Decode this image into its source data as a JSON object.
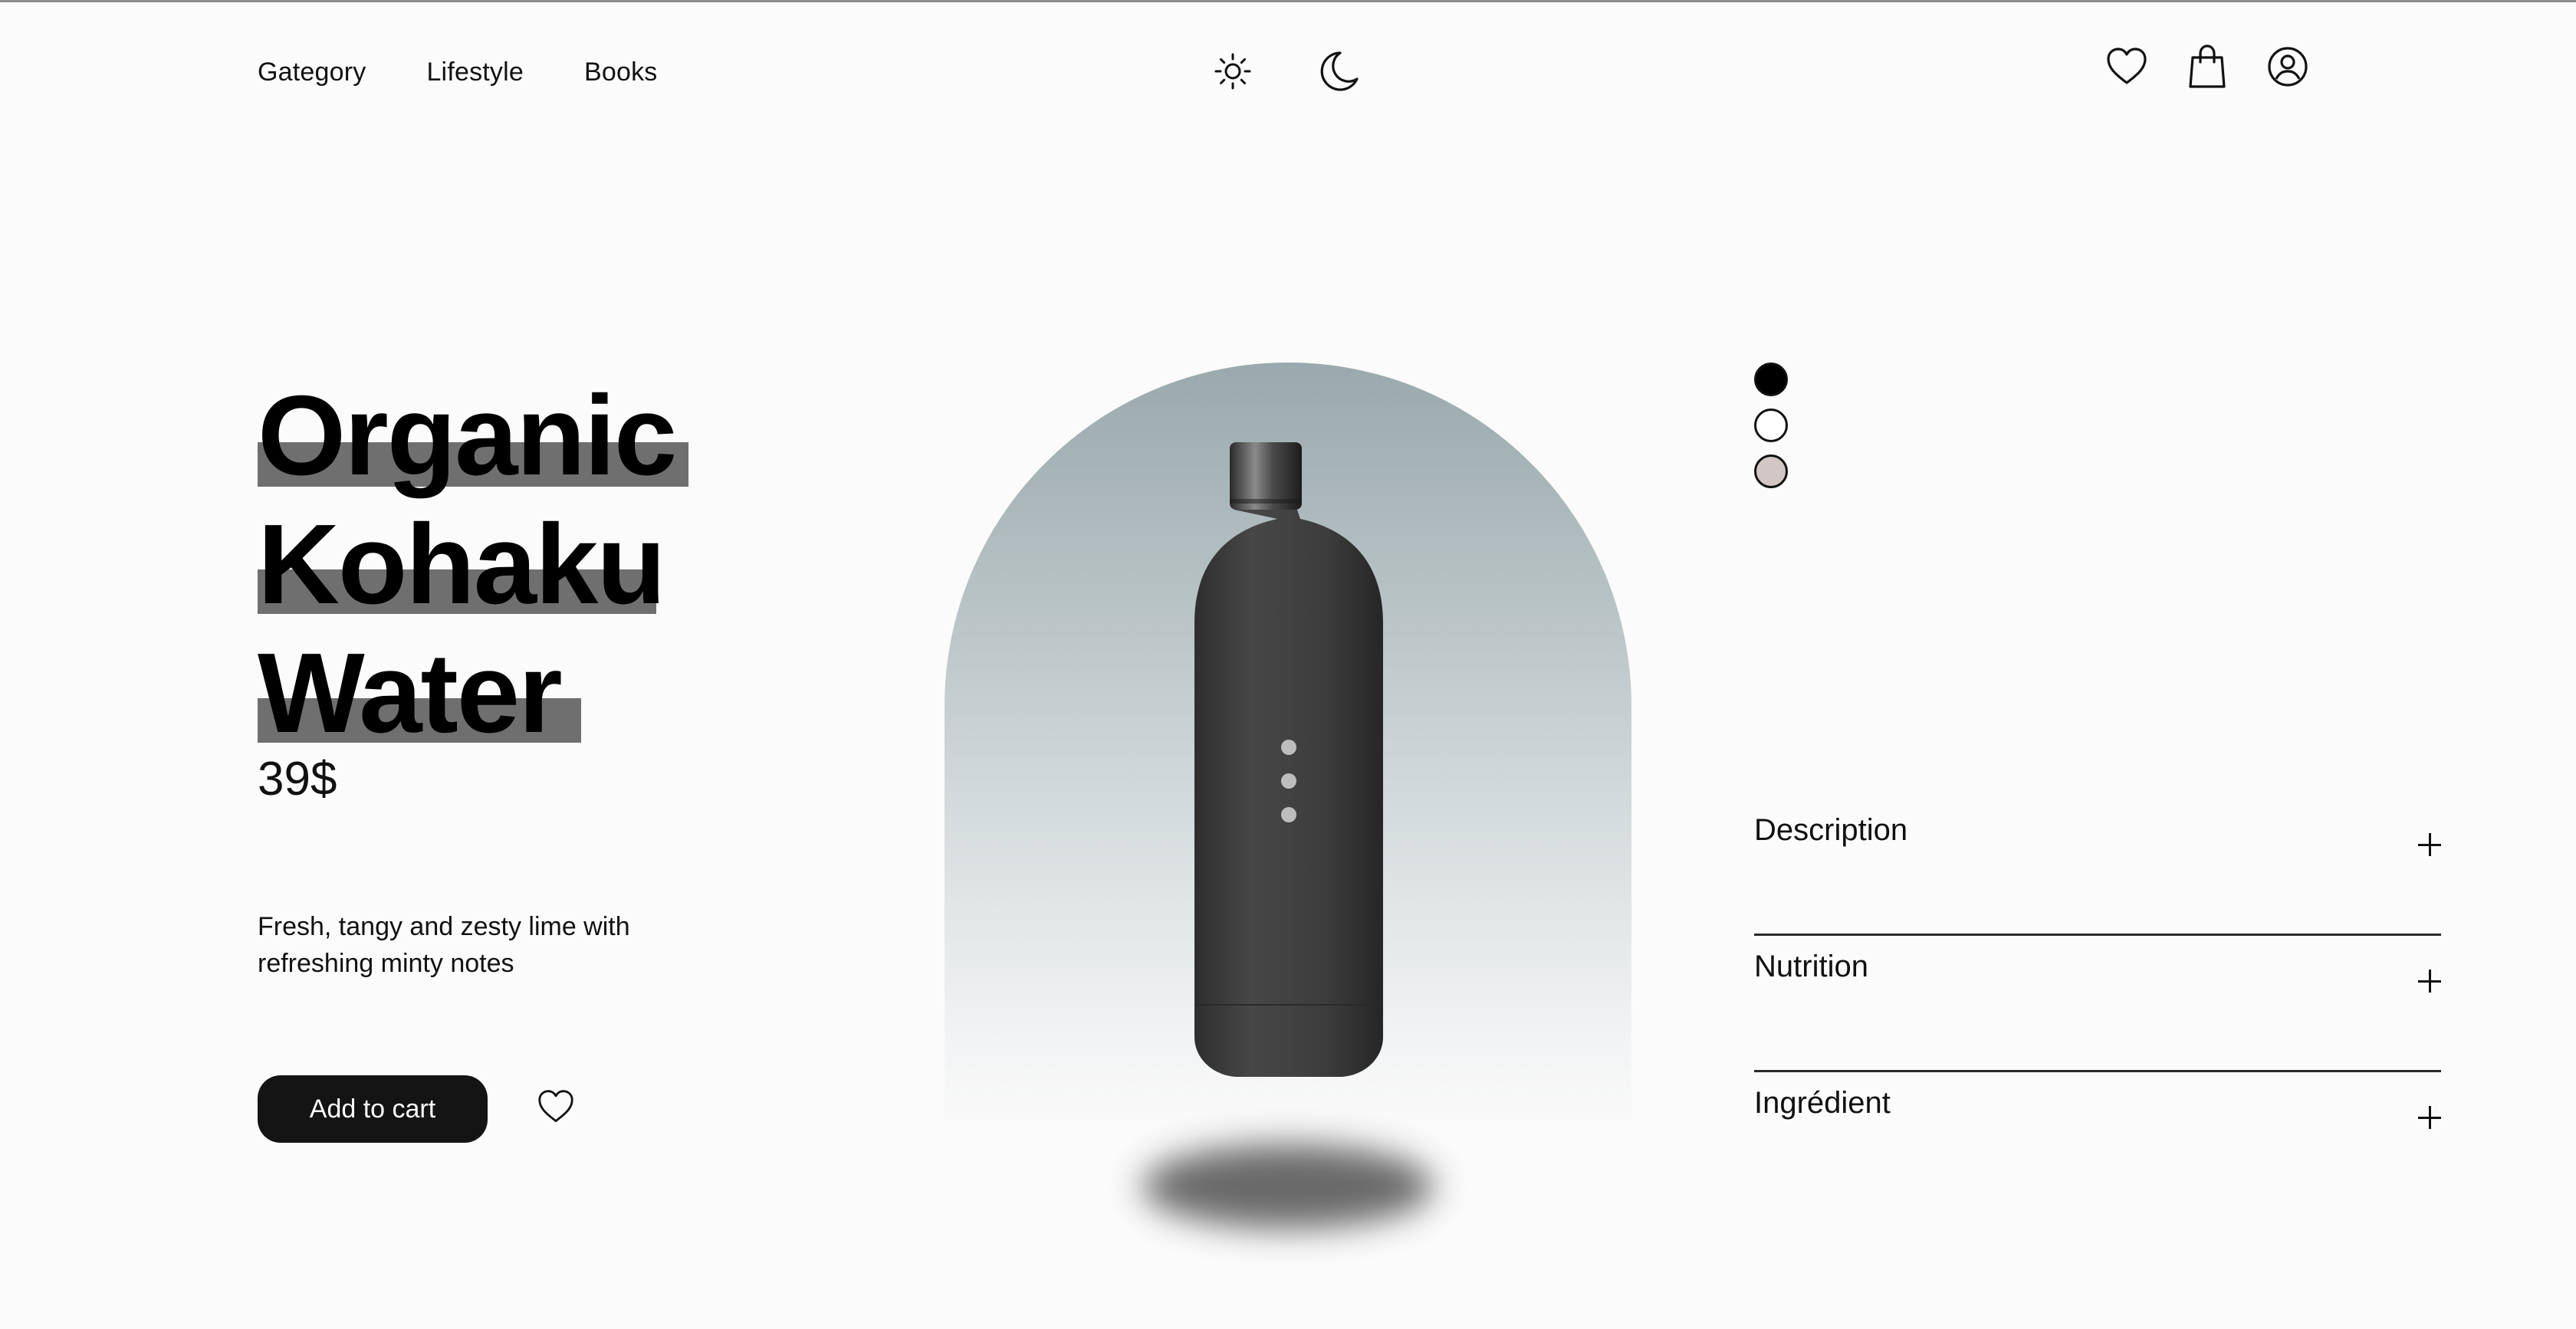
{
  "nav": {
    "links": [
      "Gategory",
      "Lifestyle",
      "Books"
    ],
    "theme_icons": [
      "sun-icon",
      "moon-icon"
    ],
    "action_icons": [
      "heart-icon",
      "shopping-bag-icon",
      "user-circle-icon"
    ]
  },
  "product": {
    "title_lines": [
      "Organic",
      "Kohaku",
      "Water"
    ],
    "price": "39$",
    "description": "Fresh, tangy and zesty lime with refreshing minty notes",
    "add_to_cart_label": "Add to cart",
    "colors": [
      "#000000",
      "#ffffff",
      "#d2c7c4"
    ],
    "selected_color": "#000000"
  },
  "accordion": {
    "items": [
      "Description",
      "Nutrition",
      "Ingrédient"
    ]
  },
  "theme": {
    "accent": "#141414",
    "highlight": "#6e6f6e",
    "background": "#fafbfa"
  }
}
